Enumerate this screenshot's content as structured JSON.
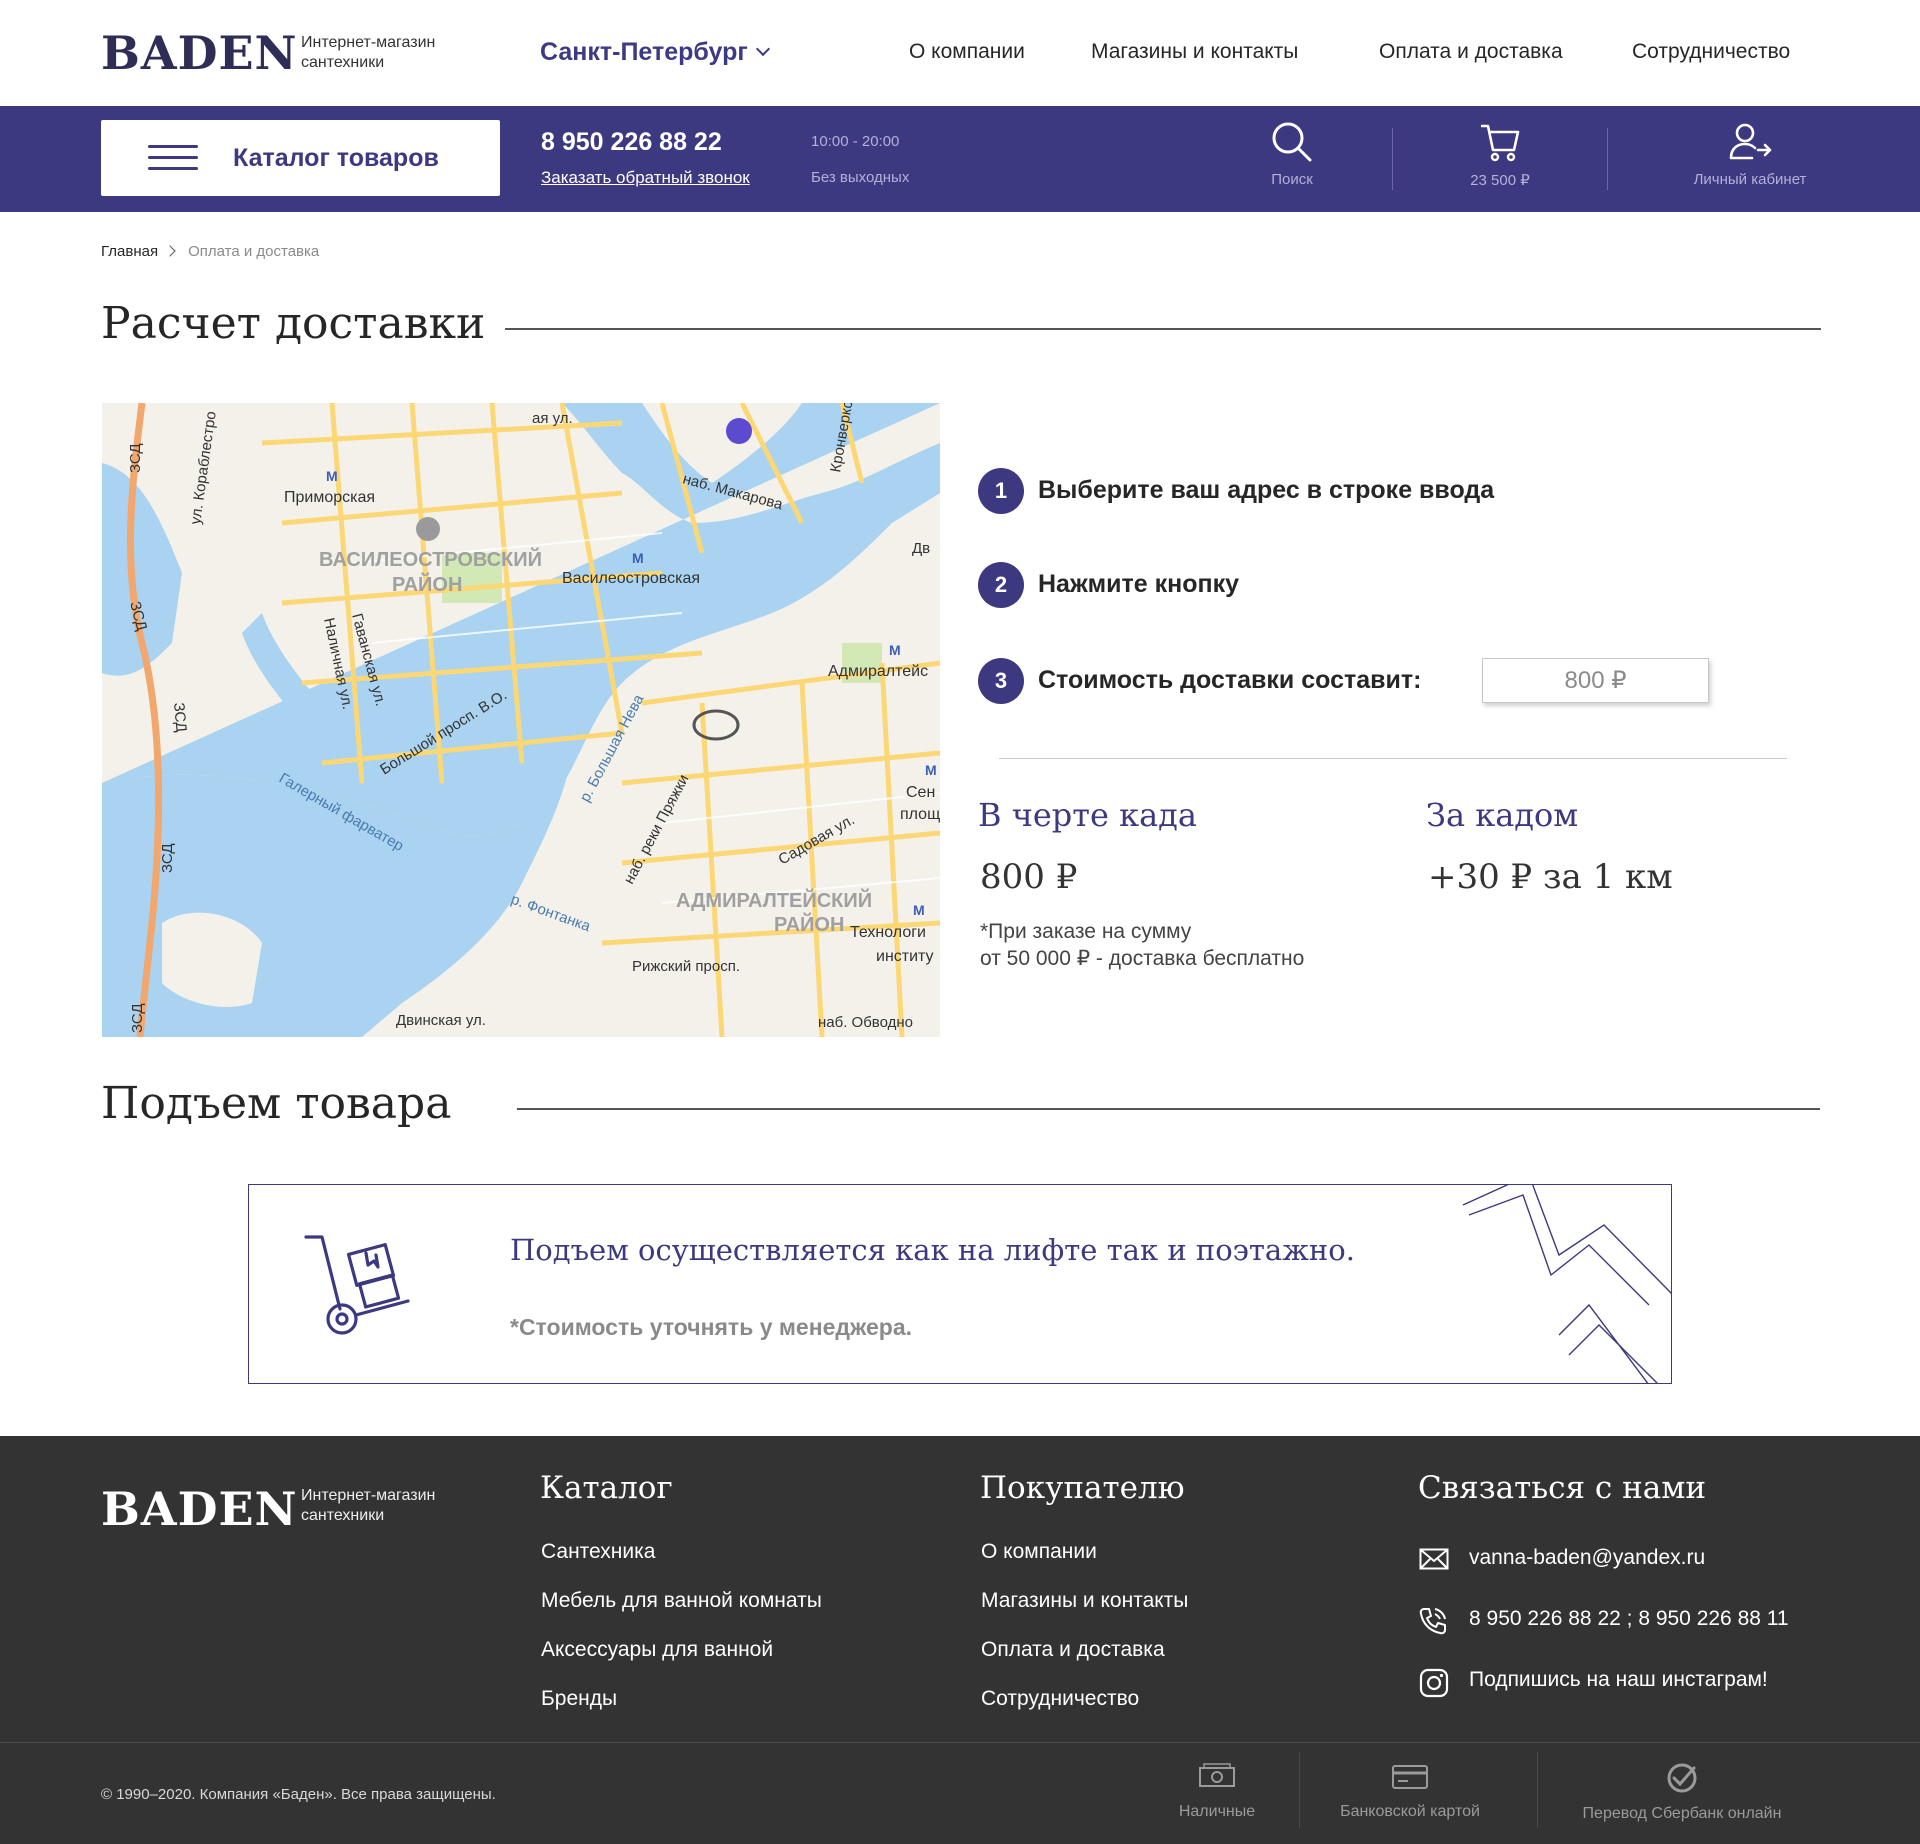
{
  "brand": {
    "logo": "BADEN",
    "tagline_line1": "Интернет-магазин",
    "tagline_line2": "сантехники"
  },
  "header": {
    "city": "Санкт-Петербург",
    "nav": [
      "О компании",
      "Магазины и контакты",
      "Оплата и доставка",
      "Сотрудничество"
    ]
  },
  "bar": {
    "catalog_label": "Каталог товаров",
    "phone": "8 950 226 88 22",
    "callback": "Заказать обратный звонок",
    "hours": "10:00 - 20:00",
    "days": "Без выходных",
    "search_label": "Поиск",
    "cart_label": "23 500 ₽",
    "account_label": "Личный кабинет"
  },
  "breadcrumbs": {
    "home": "Главная",
    "current": "Оплата и доставка"
  },
  "delivery": {
    "title": "Расчет доставки",
    "steps": [
      {
        "num": "1",
        "text": "Выберите ваш адрес в строке ввода"
      },
      {
        "num": "2",
        "text": "Нажмите кнопку"
      },
      {
        "num": "3",
        "text": "Стоимость доставки составит:"
      }
    ],
    "cost_value": "800 ₽",
    "inside": {
      "title": "В черте када",
      "price": "800 ₽",
      "note_line1": "*При заказе на сумму",
      "note_line2": "от 50 000 ₽ - доставка бесплатно"
    },
    "outside": {
      "title": "За кадом",
      "price": "+30 ₽ за 1 км"
    }
  },
  "map": {
    "labels": {
      "primorskaya": "Приморская",
      "vasileostrovskaya": "Василеостровская",
      "vas_district_1": "ВАСИЛЕОСТРОВСКИЙ",
      "vas_district_2": "РАЙОН",
      "adm_district_1": "АДМИРАЛТЕЙСКИЙ",
      "adm_district_2": "РАЙОН",
      "admiralteyskaya": "Адмиралтейс",
      "tech_1": "Технологи",
      "tech_2": "институ",
      "sen_1": "Сен",
      "sen_2": "площ",
      "makarova": "наб. Макарова",
      "kronverk": "Кронверкс",
      "korablestroiteley": "ул. Кораблестро",
      "gavanskaya": "Гаванская ул.",
      "nalichnaya": "Наличная ул.",
      "bolshoy": "Большой просп. В.О.",
      "galerny": "Галерный фарватер",
      "bolshaya_neva": "р. Большая Нева",
      "fontanka": "р. Фонтанка",
      "pryazhki": "наб. реки Пряжки",
      "sadovaya": "Садовая ул.",
      "rizhsky": "Рижский просп.",
      "dvinskaya": "Двинская ул.",
      "obvodny": "наб. Обводно",
      "zsd": "ЗСД",
      "top_street": "ая ул.",
      "dv": "Дв"
    },
    "colors": {
      "water": "#a9d3f0",
      "land": "#f4f1ea",
      "road": "#fbd776",
      "highway": "#f2a76e",
      "park": "#d2e9b6"
    }
  },
  "lift": {
    "title": "Подъем товара",
    "text": "Подъем осуществляется как на лифте так и поэтажно.",
    "note": "*Стоимость уточнять у менеджера."
  },
  "footer": {
    "catalog_head": "Каталог",
    "catalog_links": [
      "Сантехника",
      "Мебель для ванной комнаты",
      "Аксессуары для ванной",
      "Бренды"
    ],
    "buyer_head": "Покупателю",
    "buyer_links": [
      "О компании",
      "Магазины и контакты",
      "Оплата и доставка",
      "Сотрудничество"
    ],
    "contact_head": "Связаться с нами",
    "email": "vanna-baden@yandex.ru",
    "phones": "8 950 226 88 22 ; 8 950 226 88 11",
    "instagram": "Подпишись на наш инстаграм!",
    "copyright": "© 1990–2020. Компания «Баден». Все права защищены.",
    "payments": [
      "Наличные",
      "Банковской картой",
      "Перевод Сбербанк онлайн"
    ]
  },
  "colors": {
    "accent": "#3d3980",
    "footer_bg": "#333333"
  }
}
